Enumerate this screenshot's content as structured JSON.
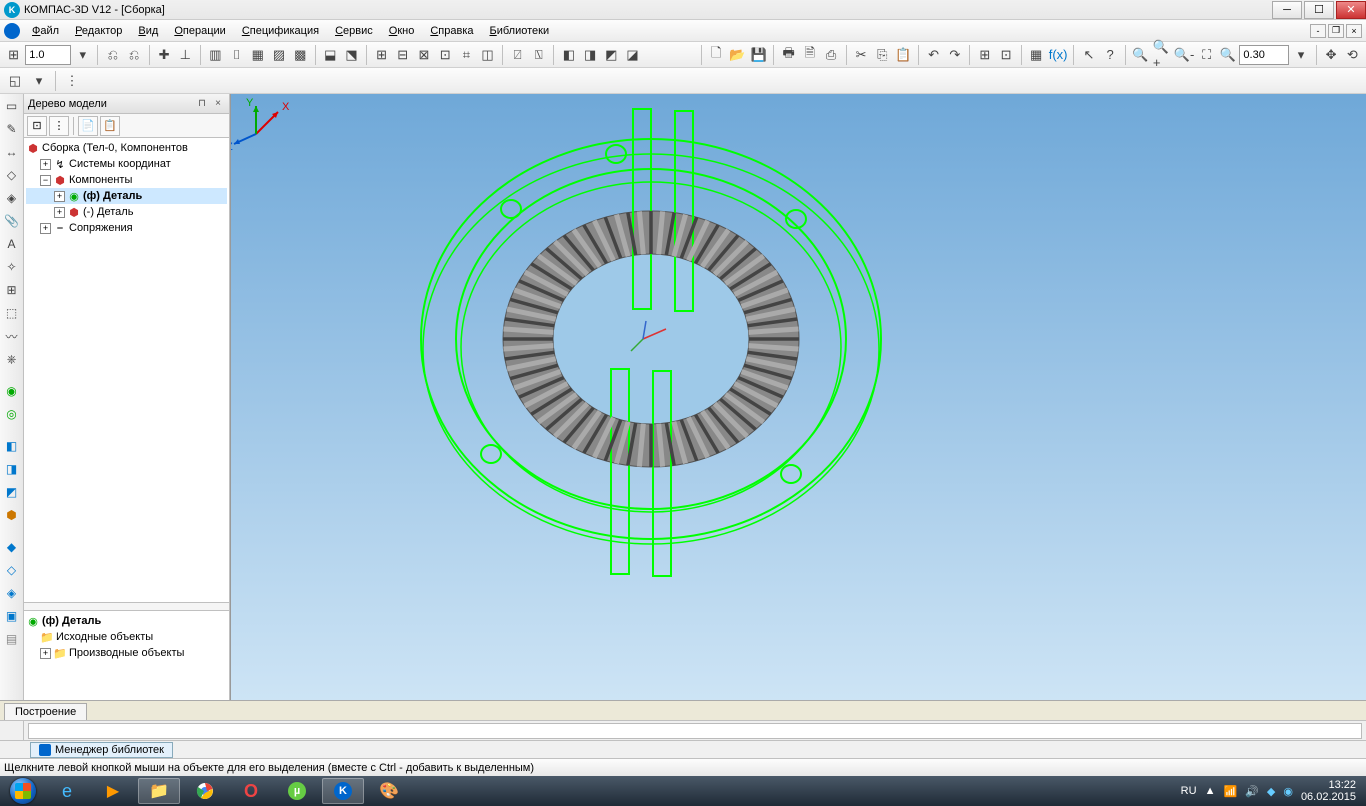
{
  "title": "КОМПАС-3D V12 - [Сборка]",
  "menu": [
    "Файл",
    "Редактор",
    "Вид",
    "Операции",
    "Спецификация",
    "Сервис",
    "Окно",
    "Справка",
    "Библиотеки"
  ],
  "toolbar1": {
    "scale_value": "1.0",
    "zoom_value": "0.30"
  },
  "tree": {
    "title": "Дерево модели",
    "root": "Сборка (Тел-0, Компонентов",
    "n1": "Системы координат",
    "n2": "Компоненты",
    "n2a": "(ф) Деталь",
    "n2b": "(-) Деталь",
    "n3": "Сопряжения",
    "sel": "(ф) Деталь",
    "sub1": "Исходные объекты",
    "sub2": "Производные объекты"
  },
  "axis": {
    "x": "X",
    "y": "Y",
    "z": "Z"
  },
  "tabs": {
    "build": "Построение"
  },
  "library_tab": "Менеджер библиотек",
  "status": "Щелкните левой кнопкой мыши на объекте для его выделения (вместе с Ctrl - добавить к выделенным)",
  "tray": {
    "lang": "RU",
    "time": "13:22",
    "date": "06.02.2015"
  }
}
